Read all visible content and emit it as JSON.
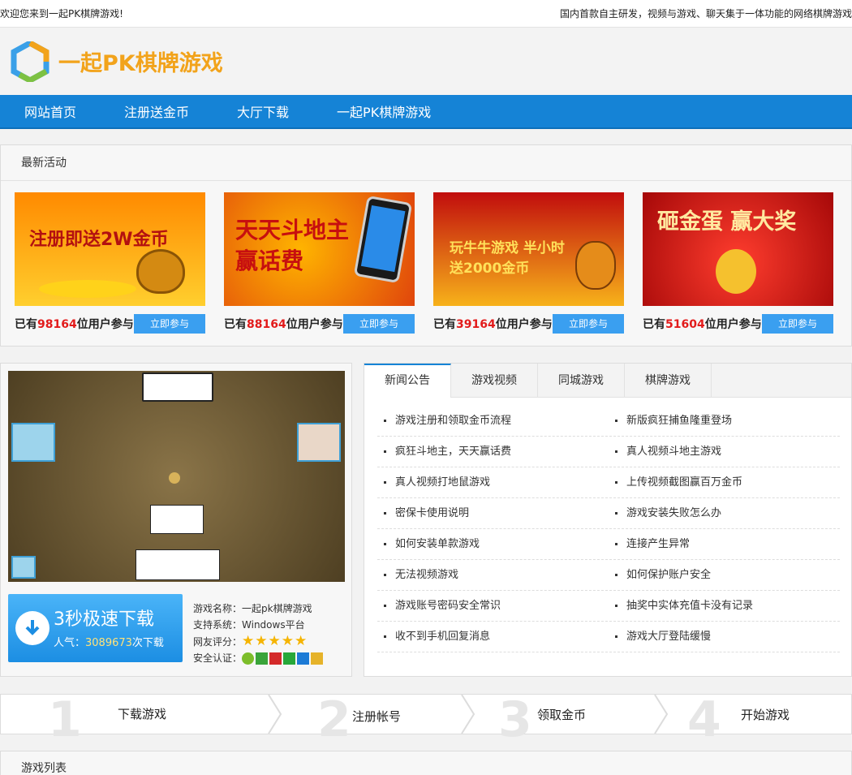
{
  "topbar": {
    "welcome": "欢迎您来到一起PK棋牌游戏!",
    "slogan": "国内首款自主研发，视频与游戏、聊天集于一体功能的网络棋牌游戏"
  },
  "header": {
    "logo_text": "一起PK棋牌游戏"
  },
  "nav": {
    "items": [
      "网站首页",
      "注册送金币",
      "大厅下载",
      "一起PK棋牌游戏"
    ]
  },
  "activities": {
    "title": "最新活动",
    "prefix": "已有",
    "suffix": "位用户参与",
    "button": "立即参与",
    "items": [
      {
        "banner_text": "注册即送2W金币",
        "count": "98164"
      },
      {
        "banner_text": "天天斗地主赢话费",
        "count": "88164"
      },
      {
        "banner_text": "玩牛牛游戏 半小时送2000金币",
        "count": "39164"
      },
      {
        "banner_text": "砸金蛋 赢大奖",
        "count": "51604"
      }
    ]
  },
  "game": {
    "download_title": "3秒极速下载",
    "popularity_label": "人气：",
    "popularity_value": "3089673",
    "popularity_suffix": "次下载",
    "name_label": "游戏名称：",
    "name_value": "一起pk棋牌游戏",
    "system_label": "支持系统：",
    "system_value": "Windows平台",
    "rating_label": "网友评分：",
    "rating_stars": 5,
    "security_label": "安全认证："
  },
  "news": {
    "tabs": [
      "新闻公告",
      "游戏视频",
      "同城游戏",
      "棋牌游戏"
    ],
    "rows": [
      [
        "游戏注册和领取金币流程",
        "新版疯狂捕鱼隆重登场"
      ],
      [
        "疯狂斗地主，天天赢话费",
        "真人视频斗地主游戏"
      ],
      [
        "真人视频打地鼠游戏",
        "上传视频截图赢百万金币"
      ],
      [
        "密保卡使用说明",
        "游戏安装失败怎么办"
      ],
      [
        "如何安装单款游戏",
        "连接产生异常"
      ],
      [
        "无法视频游戏",
        "如何保护账户安全"
      ],
      [
        "游戏账号密码安全常识",
        "抽奖中实体充值卡没有记录"
      ],
      [
        "收不到手机回复消息",
        "游戏大厅登陆缓慢"
      ]
    ]
  },
  "steps": [
    {
      "num": "1",
      "label": "下载游戏"
    },
    {
      "num": "2",
      "label": "注册帐号"
    },
    {
      "num": "3",
      "label": "领取金币"
    },
    {
      "num": "4",
      "label": "开始游戏"
    }
  ],
  "game_list": {
    "title": "游戏列表"
  },
  "colors": {
    "nav_blue": "#1583d6",
    "accent_red": "#e21b1b",
    "logo_orange": "#f2a31b"
  }
}
